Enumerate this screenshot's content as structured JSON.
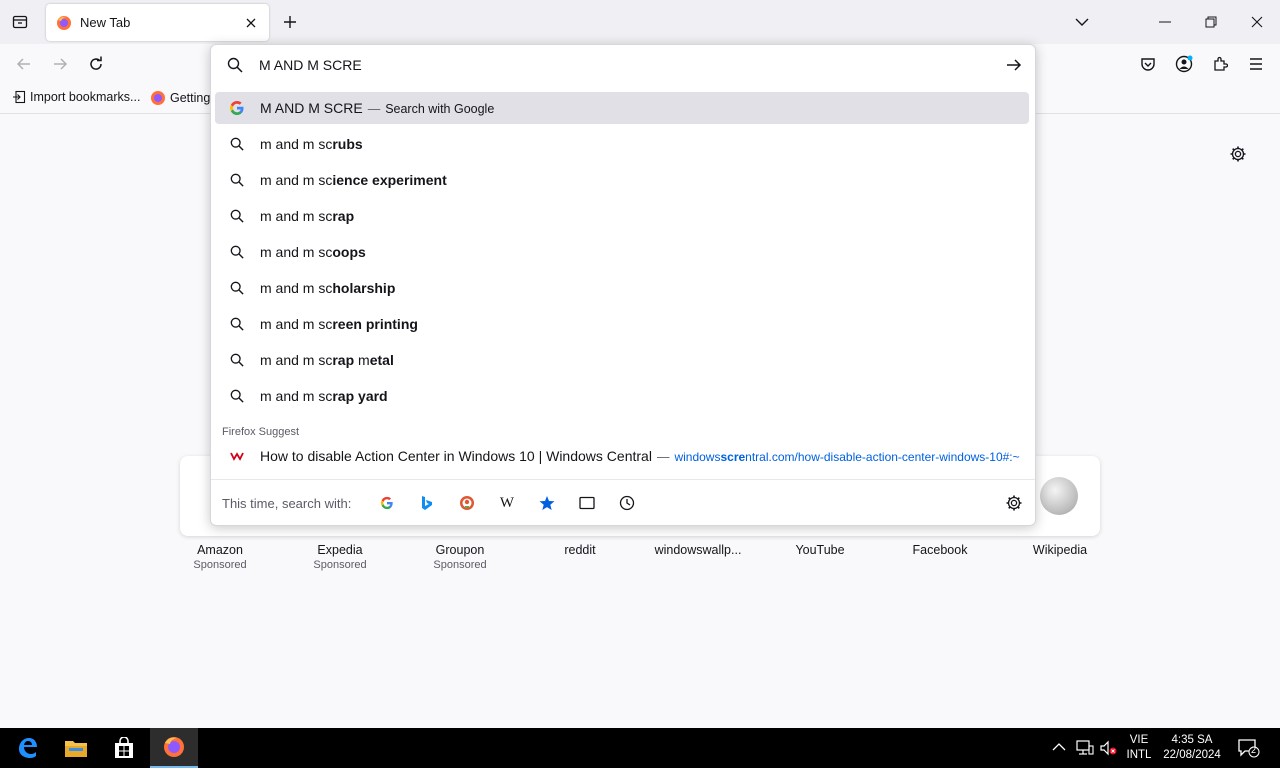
{
  "browser": {
    "tab_title": "New Tab",
    "bookmarks": [
      {
        "label": "Import bookmarks..."
      },
      {
        "label": "Getting"
      }
    ]
  },
  "urlbar": {
    "input_value": "M AND M SCRE",
    "rows": [
      {
        "typed": "M AND M SCRE",
        "bold": "",
        "suffix": "Search with Google"
      },
      {
        "typed": "m and m sc",
        "bold": "rubs"
      },
      {
        "typed": "m and m sc",
        "bold": "ience experiment"
      },
      {
        "typed": "m and m sc",
        "bold": "rap"
      },
      {
        "typed": "m and m sc",
        "bold": "oops"
      },
      {
        "typed": "m and m sc",
        "bold": "holarship"
      },
      {
        "typed": "m and m sc",
        "bold": "reen printing"
      },
      {
        "typed": "m and m sc",
        "bold": "rap",
        "typed2": " m",
        "bold2": "etal"
      },
      {
        "typed": "m and m sc",
        "bold": "rap yard"
      }
    ],
    "group_label": "Firefox Suggest",
    "suggest": {
      "title": "How to disable Action Center in Windows 10 | Windows Central",
      "url_prefix": "windows",
      "url_bold": "scre",
      "url_mid": "ntral.com",
      "url_rest": "/how-disable-action-center-windows-10#:~"
    },
    "oneoff_label": "This time, search with:"
  },
  "tiles": [
    {
      "name": "Amazon",
      "sub": "Sponsored"
    },
    {
      "name": "Expedia",
      "sub": "Sponsored"
    },
    {
      "name": "Groupon",
      "sub": "Sponsored"
    },
    {
      "name": "reddit",
      "sub": ""
    },
    {
      "name": "windowswallp...",
      "sub": ""
    },
    {
      "name": "YouTube",
      "sub": ""
    },
    {
      "name": "Facebook",
      "sub": ""
    },
    {
      "name": "Wikipedia",
      "sub": ""
    }
  ],
  "taskbar": {
    "lang1": "VIE",
    "lang2": "INTL",
    "time": "4:35 SA",
    "date": "22/08/2024",
    "notif_count": "2"
  },
  "colors": {
    "accent": "#0061e0",
    "selected_row": "#e0e0e6",
    "taskbar": "#000000"
  }
}
